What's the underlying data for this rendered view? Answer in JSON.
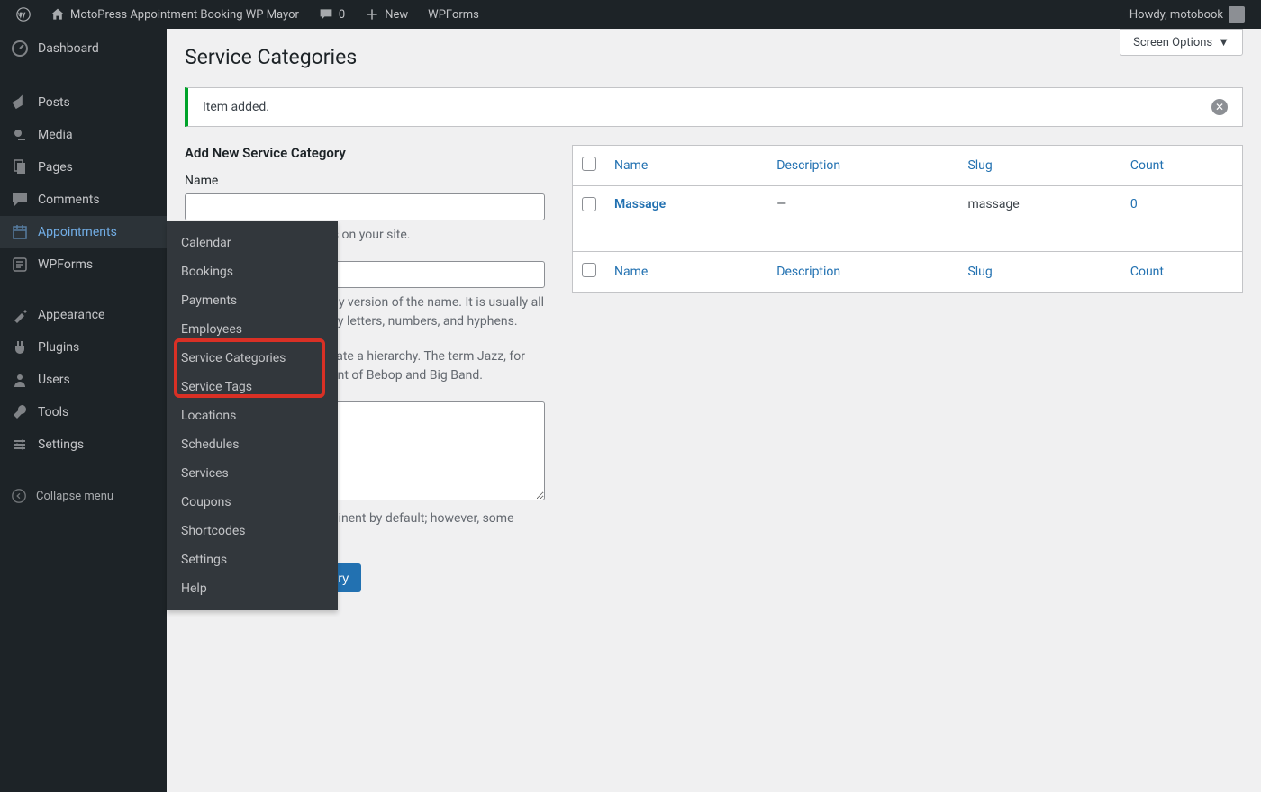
{
  "topbar": {
    "site_name": "MotoPress Appointment Booking WP Mayor",
    "comments_count": "0",
    "new_label": "New",
    "wpforms_label": "WPForms",
    "greeting": "Howdy, motobook"
  },
  "sidebar": {
    "items": [
      {
        "label": "Dashboard",
        "icon": "dashboard"
      },
      {
        "label": "Posts",
        "icon": "pin"
      },
      {
        "label": "Media",
        "icon": "media"
      },
      {
        "label": "Pages",
        "icon": "page"
      },
      {
        "label": "Comments",
        "icon": "comment"
      },
      {
        "label": "Appointments",
        "icon": "calendar",
        "active": true
      },
      {
        "label": "WPForms",
        "icon": "form"
      },
      {
        "label": "Appearance",
        "icon": "brush"
      },
      {
        "label": "Plugins",
        "icon": "plug"
      },
      {
        "label": "Users",
        "icon": "user"
      },
      {
        "label": "Tools",
        "icon": "wrench"
      },
      {
        "label": "Settings",
        "icon": "settings"
      }
    ],
    "collapse_label": "Collapse menu"
  },
  "flyout": {
    "items": [
      "Calendar",
      "Bookings",
      "Payments",
      "Employees",
      "Service Categories",
      "Service Tags",
      "Locations",
      "Schedules",
      "Services",
      "Coupons",
      "Shortcodes",
      "Settings",
      "Help"
    ]
  },
  "main": {
    "screen_options": "Screen Options",
    "title": "Service Categories",
    "notice": "Item added.",
    "form": {
      "heading": "Add New Service Category",
      "name_label": "Name",
      "name_help": "The name is how it appears on your site.",
      "slug_help": "The \"slug\" is the URL-friendly version of the name. It is usually all lowercase and contains only letters, numbers, and hyphens.",
      "parent_help": "Assign a parent term to create a hierarchy. The term Jazz, for example, would be the parent of Bebop and Big Band.",
      "description_help": "The description is not prominent by default; however, some themes may show it.",
      "submit": "Add New Service Category"
    },
    "table": {
      "cols": {
        "name": "Name",
        "description": "Description",
        "slug": "Slug",
        "count": "Count"
      },
      "rows": [
        {
          "name": "Massage",
          "description": "—",
          "slug": "massage",
          "count": "0"
        }
      ]
    }
  }
}
